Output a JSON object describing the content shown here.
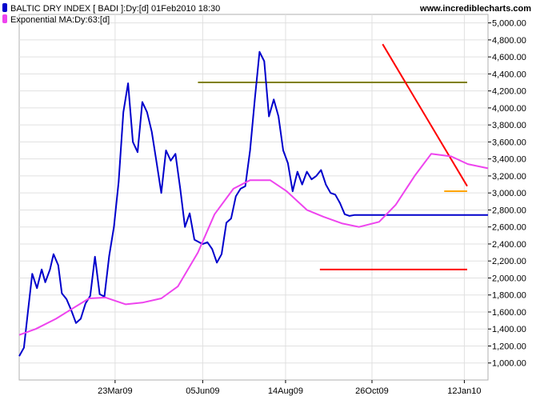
{
  "header": {
    "watermark": "www.incrediblecharts.com"
  },
  "legend": {
    "position": "top-left",
    "items": [
      {
        "label": "BALTIC DRY INDEX [ BADI ]:Dy:[d]  01Feb2010 18:30",
        "color": "#0000cc"
      },
      {
        "label": "Exponential MA:Dy:63:[d]",
        "color": "#ee44ee"
      }
    ]
  },
  "chart_data": {
    "type": "line",
    "title": "",
    "xlabel": "",
    "ylabel": "",
    "ylim": [
      800,
      5100
    ],
    "xlim": [
      "2009-01-01",
      "2010-02-01"
    ],
    "grid": true,
    "y_axis_side": "right",
    "y_ticks": [
      1000,
      1200,
      1400,
      1600,
      1800,
      2000,
      2200,
      2400,
      2600,
      2800,
      3000,
      3200,
      3400,
      3600,
      3800,
      4000,
      4200,
      4400,
      4600,
      4800,
      5000
    ],
    "y_tick_labels": [
      "1,000.00",
      "1,200.00",
      "1,400.00",
      "1,600.00",
      "1,800.00",
      "2,000.00",
      "2,200.00",
      "2,400.00",
      "2,600.00",
      "2,800.00",
      "3,000.00",
      "3,200.00",
      "3,400.00",
      "3,600.00",
      "3,800.00",
      "4,000.00",
      "4,200.00",
      "4,400.00",
      "4,600.00",
      "4,800.00",
      "5,000.00"
    ],
    "x_ticks": [
      {
        "date": "2009-03-23",
        "label": "23Mar09"
      },
      {
        "date": "2009-06-05",
        "label": "05Jun09"
      },
      {
        "date": "2009-08-14",
        "label": "14Aug09"
      },
      {
        "date": "2009-10-26",
        "label": "26Oct09"
      },
      {
        "date": "2010-01-12",
        "label": "12Jan10"
      }
    ],
    "series": [
      {
        "name": "BALTIC DRY INDEX [ BADI ]:Dy:[d]",
        "color": "#0000cc",
        "x": [
          "2009-01-01",
          "2009-01-05",
          "2009-01-08",
          "2009-01-12",
          "2009-01-16",
          "2009-01-20",
          "2009-01-23",
          "2009-01-27",
          "2009-01-30",
          "2009-02-03",
          "2009-02-06",
          "2009-02-10",
          "2009-02-14",
          "2009-02-18",
          "2009-02-22",
          "2009-02-26",
          "2009-03-02",
          "2009-03-06",
          "2009-03-10",
          "2009-03-14",
          "2009-03-18",
          "2009-03-22",
          "2009-03-26",
          "2009-03-30",
          "2009-04-03",
          "2009-04-07",
          "2009-04-11",
          "2009-04-15",
          "2009-04-19",
          "2009-04-23",
          "2009-04-27",
          "2009-05-01",
          "2009-05-05",
          "2009-05-09",
          "2009-05-13",
          "2009-05-17",
          "2009-05-21",
          "2009-05-25",
          "2009-05-29",
          "2009-06-02",
          "2009-06-05",
          "2009-06-09",
          "2009-06-13",
          "2009-06-17",
          "2009-06-21",
          "2009-06-25",
          "2009-06-29",
          "2009-07-03",
          "2009-07-07",
          "2009-07-11",
          "2009-07-15",
          "2009-07-19",
          "2009-07-23",
          "2009-07-27",
          "2009-07-31",
          "2009-08-04",
          "2009-08-08",
          "2009-08-12",
          "2009-08-16",
          "2009-08-20",
          "2009-08-24",
          "2009-08-28",
          "2009-09-01",
          "2009-09-05",
          "2009-09-09",
          "2009-09-13",
          "2009-09-17",
          "2009-09-21",
          "2009-09-25",
          "2009-09-29",
          "2009-10-03",
          "2009-10-07",
          "2009-10-11",
          "2009-10-15",
          "2009-10-19",
          "2009-10-23",
          "2009-10-27",
          "2009-10-31",
          "2009-11-04",
          "2009-11-08",
          "2009-11-12",
          "2009-11-16",
          "2009-11-20",
          "2009-11-24",
          "2009-11-28",
          "2009-12-02",
          "2009-12-06",
          "2009-12-10",
          "2009-12-14",
          "2009-12-18",
          "2009-12-22",
          "2009-12-26",
          "2009-12-30",
          "2010-01-03",
          "2010-01-07",
          "2010-01-11",
          "2010-01-15",
          "2010-01-19",
          "2010-01-23",
          "2010-01-27",
          "2010-02-01"
        ],
        "values": [
          1080,
          1180,
          1560,
          2050,
          1880,
          2100,
          1950,
          2100,
          2280,
          2150,
          1820,
          1750,
          1620,
          1470,
          1520,
          1700,
          1790,
          2250,
          1810,
          1780,
          2260,
          2600,
          3130,
          3950,
          4290,
          3600,
          3480,
          4070,
          3950,
          3720,
          3360,
          3000,
          3500,
          3380,
          3460,
          3050,
          2600,
          2760,
          2450,
          2420,
          2400,
          2420,
          2340,
          2180,
          2280,
          2650,
          2700,
          2960,
          3050,
          3080,
          3500,
          4100,
          4660,
          4550,
          3900,
          4100,
          3900,
          3500,
          3350,
          3020,
          3250,
          3100,
          3250,
          3160,
          3200,
          3270,
          3100,
          3000,
          2980,
          2880,
          2750,
          2730,
          2740,
          2740,
          2740,
          2740,
          2740,
          2740,
          2740,
          2740,
          2740,
          2740,
          2740,
          2740,
          2740,
          2740,
          2740,
          2740,
          2740,
          2740,
          2740,
          2740,
          2740,
          2740,
          2740,
          2740,
          2740,
          2740,
          2740,
          2740,
          2740
        ]
      },
      {
        "name": "Exponential MA:Dy:63:[d]",
        "color": "#ee44ee",
        "x": [
          "2009-01-01",
          "2009-01-15",
          "2009-02-01",
          "2009-02-15",
          "2009-03-01",
          "2009-03-15",
          "2009-04-01",
          "2009-04-15",
          "2009-05-01",
          "2009-05-15",
          "2009-06-01",
          "2009-06-15",
          "2009-07-01",
          "2009-07-15",
          "2009-08-01",
          "2009-08-15",
          "2009-09-01",
          "2009-09-15",
          "2009-10-01",
          "2009-10-15",
          "2009-11-01",
          "2009-11-15",
          "2009-12-01",
          "2009-12-15",
          "2010-01-01",
          "2010-01-15",
          "2010-02-01"
        ],
        "values": [
          1330,
          1400,
          1520,
          1640,
          1760,
          1770,
          1690,
          1710,
          1760,
          1900,
          2300,
          2750,
          3050,
          3150,
          3150,
          3020,
          2800,
          2720,
          2640,
          2600,
          2660,
          2860,
          3200,
          3460,
          3430,
          3340,
          3290
        ]
      }
    ],
    "annotations": [
      {
        "type": "hline",
        "y": 4300,
        "from": "2009-06-01",
        "to": "2010-02-01",
        "color": "#808000"
      },
      {
        "type": "hline",
        "y": 2100,
        "from": "2009-09-12",
        "to": "2010-02-01",
        "color": "#ff0000"
      },
      {
        "type": "hline",
        "y": 3020,
        "from": "2009-12-26",
        "to": "2010-02-01",
        "color": "#ffa500"
      },
      {
        "type": "trendline",
        "from_date": "2009-11-04",
        "from_y": 4750,
        "to_date": "2010-02-01",
        "to_y": 3080,
        "color": "#ff0000"
      }
    ]
  }
}
